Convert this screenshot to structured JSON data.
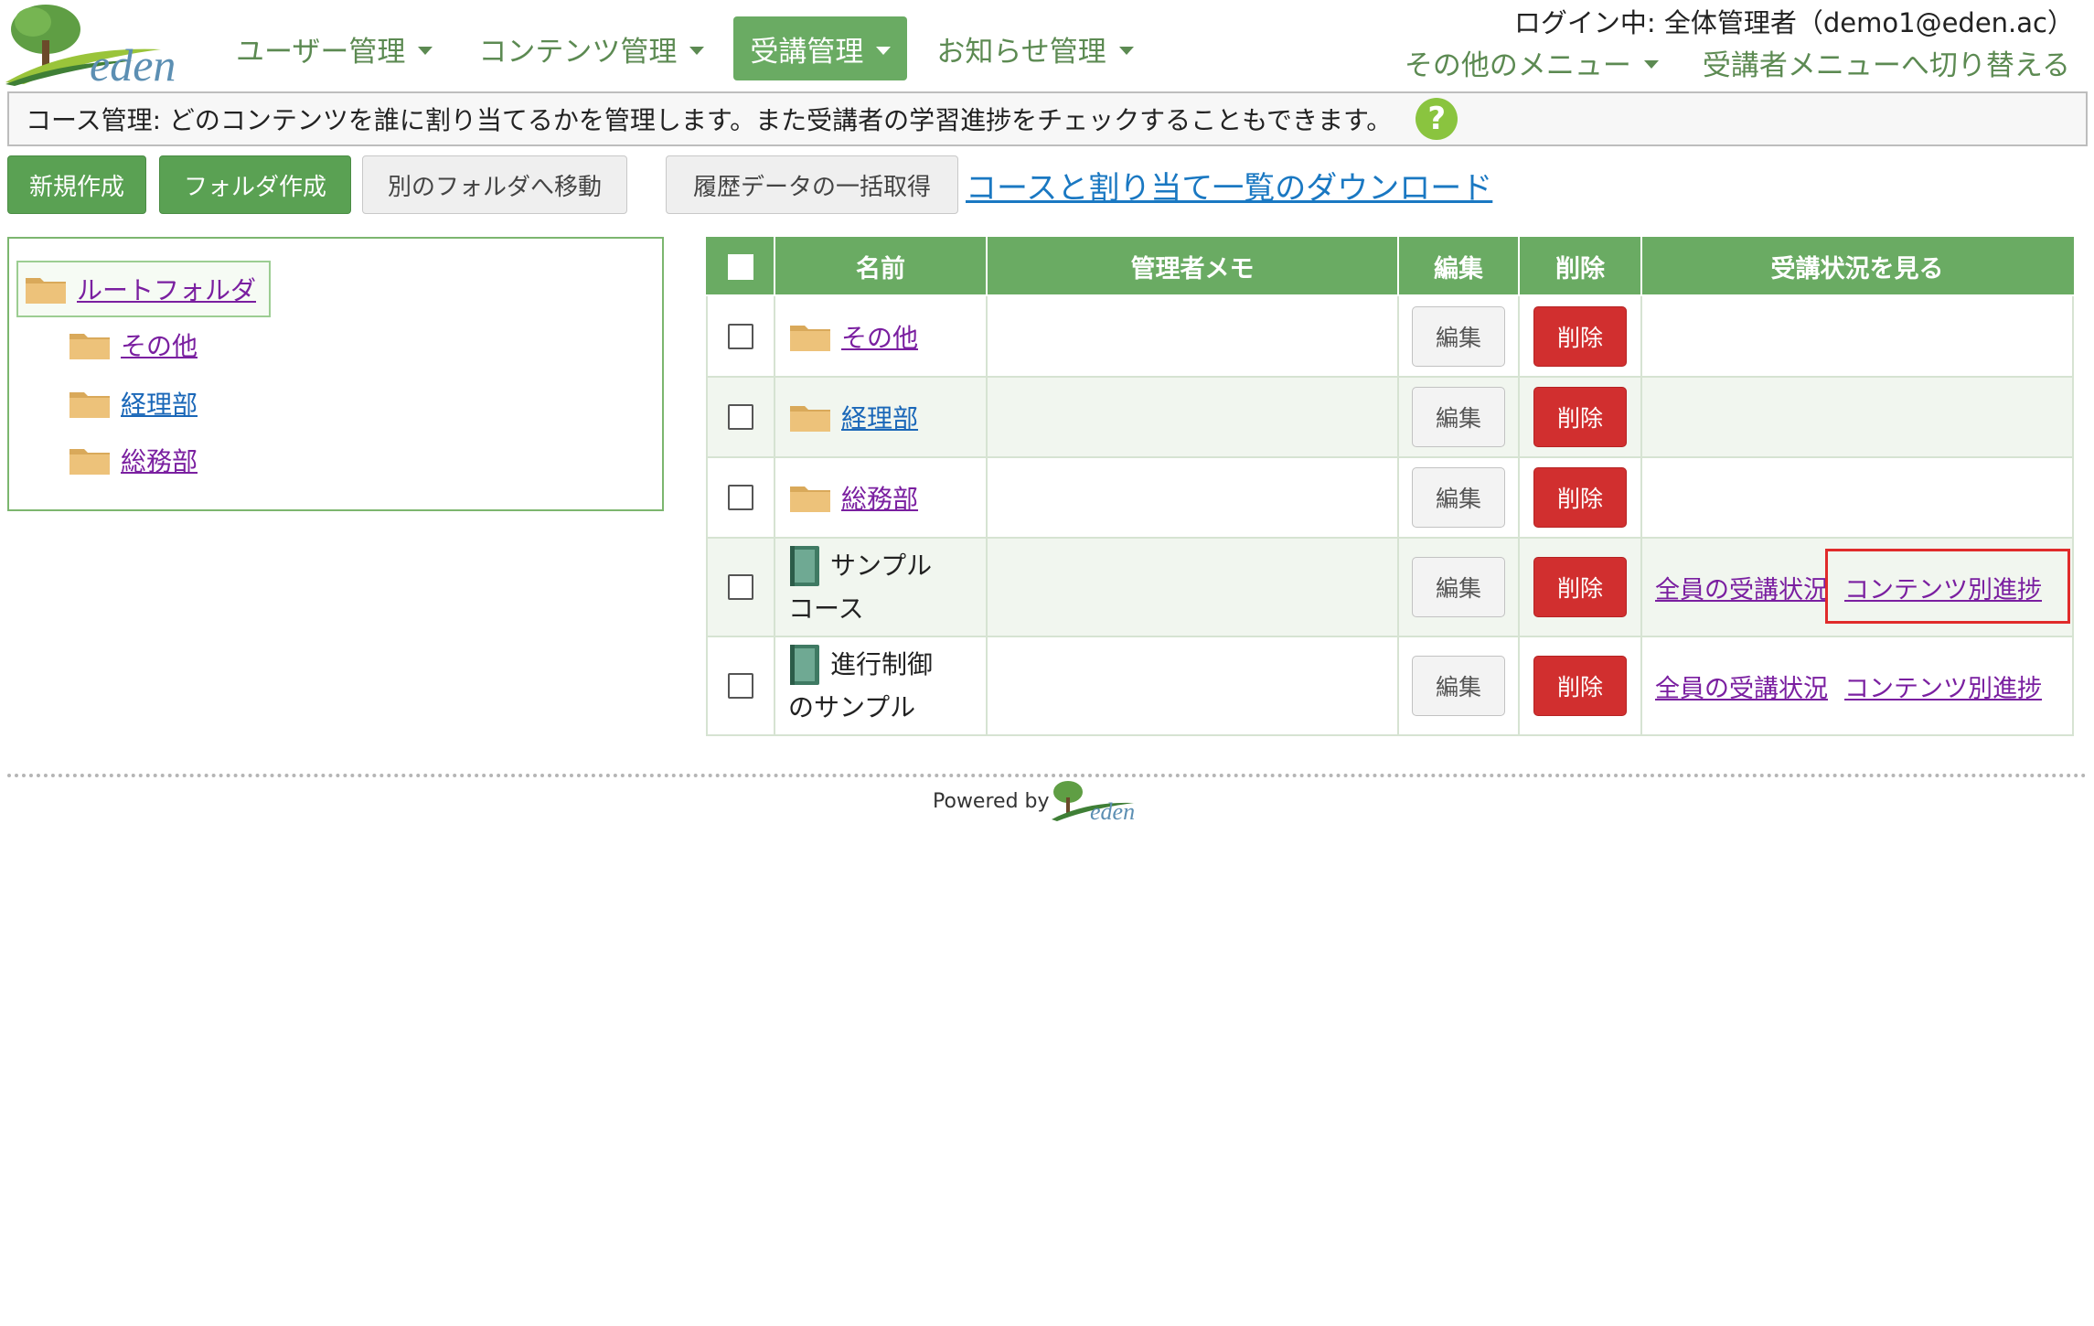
{
  "header": {
    "logo_text": "eden",
    "nav": [
      {
        "label": "ユーザー管理",
        "active": false
      },
      {
        "label": "コンテンツ管理",
        "active": false
      },
      {
        "label": "受講管理",
        "active": true
      },
      {
        "label": "お知らせ管理",
        "active": false
      }
    ],
    "login_info": "ログイン中: 全体管理者（demo1@eden.ac）",
    "other_menu": "その他のメニュー",
    "switch_menu": "受講者メニューへ切り替える"
  },
  "info": {
    "text": "コース管理: どのコンテンツを誰に割り当てるかを管理します。また受講者の学習進捗をチェックすることもできます。",
    "help_symbol": "?"
  },
  "toolbar": {
    "new": "新規作成",
    "new_folder": "フォルダ作成",
    "move": "別のフォルダへ移動",
    "history": "履歴データの一括取得",
    "download_link": "コースと割り当て一覧のダウンロード"
  },
  "tree": {
    "root": "ルートフォルダ",
    "children": [
      "その他",
      "経理部",
      "総務部"
    ]
  },
  "table": {
    "headers": {
      "name": "名前",
      "memo": "管理者メモ",
      "edit": "編集",
      "delete": "削除",
      "status": "受講状況を見る"
    },
    "rows": [
      {
        "type": "folder",
        "name": "その他",
        "memo": "",
        "edit": "編集",
        "delete": "削除"
      },
      {
        "type": "folder",
        "name": "経理部",
        "memo": "",
        "edit": "編集",
        "delete": "削除"
      },
      {
        "type": "folder",
        "name": "総務部",
        "memo": "",
        "edit": "編集",
        "delete": "削除"
      },
      {
        "type": "course",
        "name_line1": "サンプル",
        "name_line2": "コース",
        "memo": "",
        "edit": "編集",
        "delete": "削除",
        "status_all": "全員の受講状況",
        "status_content": "コンテンツ別進捗"
      },
      {
        "type": "course",
        "name_line1": "進行制御",
        "name_line2": "のサンプル",
        "memo": "",
        "edit": "編集",
        "delete": "削除",
        "status_all": "全員の受講状況",
        "status_content": "コンテンツ別進捗"
      }
    ]
  },
  "footer": {
    "powered_by": "Powered by",
    "logo_text": "eden"
  },
  "colors": {
    "brand_green": "#6aab63",
    "button_green": "#5aa153",
    "delete_red": "#d12f2f",
    "highlight_red": "#e02b2b",
    "link_purple": "#7a1fa0",
    "link_blue": "#1a67b8"
  },
  "icons": {
    "folder": "folder-icon",
    "course": "book-icon",
    "help": "help-icon",
    "dropdown": "chevron-down-icon"
  }
}
